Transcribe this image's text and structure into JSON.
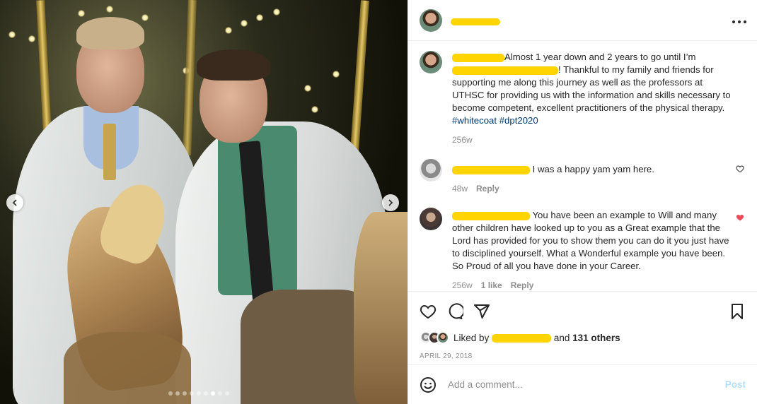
{
  "post": {
    "owner": {
      "username": "",
      "avatar_icon": "profile-photo-icon"
    },
    "caption": {
      "text": "Almost 1 year down and 2 years to go until I’m",
      "text_cont": "! Thankful to my family and friends for supporting me along this journey as well as the professors at UTHSC for providing us with the information and skills necessary to become competent, excellent practitioners of the physical therapy.",
      "hashtags": [
        "#whitecoat",
        "#dpt2020"
      ],
      "age": "256w"
    },
    "comments": [
      {
        "text": "I was a happy yam yam here.",
        "age": "48w",
        "reply_label": "Reply",
        "liked": false
      },
      {
        "text": "You have been an example to Will and many other children have looked up to you as a Great example that the Lord has provided for you to show them you can do it you just have to disciplined yourself. What a Wonderful example you have been. So Proud of all you have done in your Career.",
        "age": "256w",
        "likes": "1 like",
        "reply_label": "Reply",
        "liked": true
      }
    ],
    "likes": {
      "prefix": "Liked by",
      "suffix_and": "and",
      "others": "131 others"
    },
    "date": "APRIL 29, 2018",
    "add_comment": {
      "placeholder": "Add a comment...",
      "post_label": "Post"
    },
    "carousel": {
      "total": 9,
      "current": 7
    },
    "colors": {
      "like_red": "#ed4956",
      "link_blue": "#00376b",
      "post_disabled": "#b2dffc",
      "redaction": "#ffd400"
    }
  }
}
